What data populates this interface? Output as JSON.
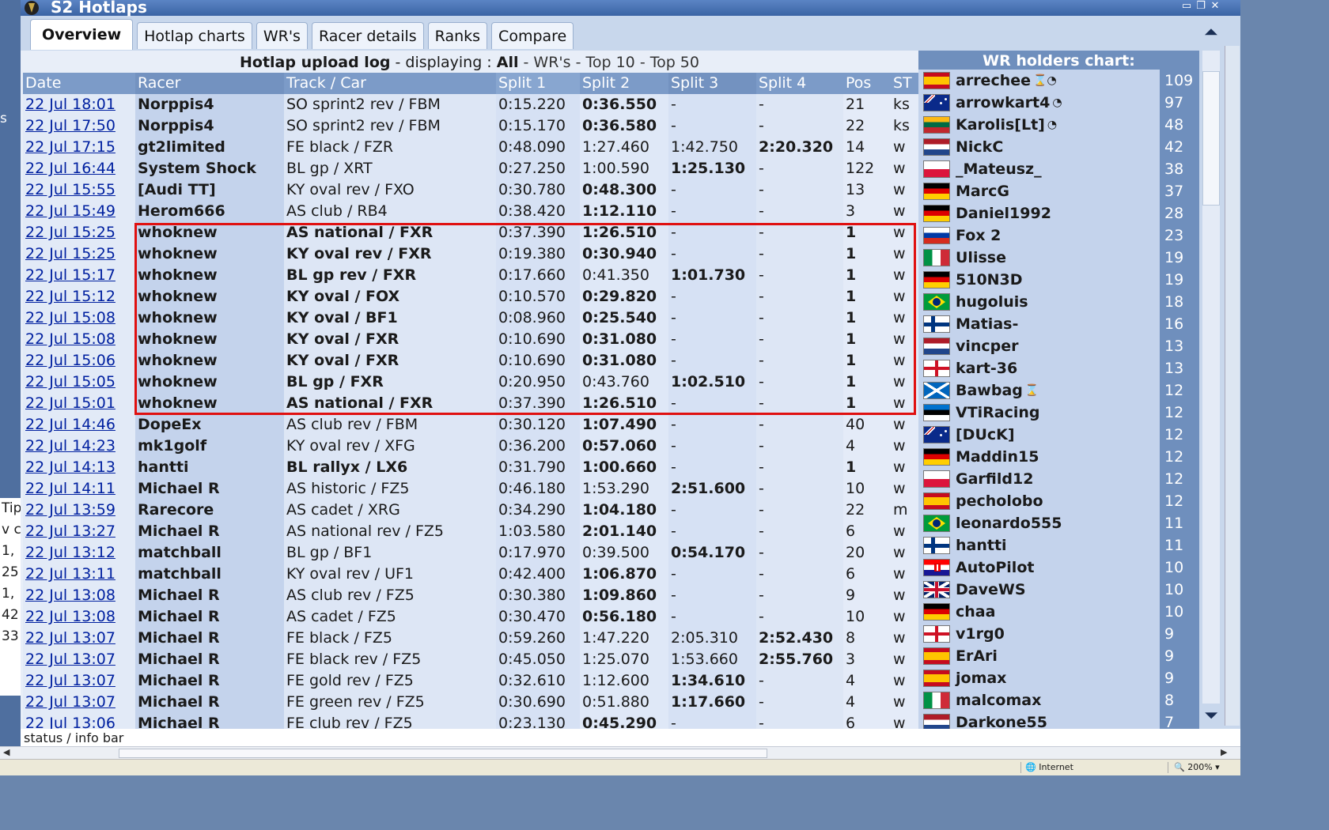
{
  "window": {
    "title": "S2 Hotlaps",
    "buttons": [
      "▭",
      "❐",
      "✕"
    ]
  },
  "background": {
    "left_char": "s",
    "left_lines": [
      "",
      "Tips",
      "v c",
      "1,",
      "25",
      "",
      "1,",
      "42",
      "33"
    ]
  },
  "tabs": [
    "Overview",
    "Hotlap charts",
    "WR's",
    "Racer details",
    "Ranks",
    "Compare"
  ],
  "log": {
    "title": "Hotlap upload log",
    "displaying": "- displaying :",
    "all": "All",
    "links": [
      "- WR's -",
      "Top 10",
      "- Top 50"
    ]
  },
  "table": {
    "headers": [
      "Date",
      "Racer",
      "Track / Car",
      "Split 1",
      "Split 2",
      "Split 3",
      "Split 4",
      "Pos",
      "ST"
    ],
    "rows": [
      {
        "date": "22 Jul 18:01",
        "racer": "Norppis4",
        "track": "SO sprint2 rev / FBM",
        "s1": "0:15.220",
        "s2": "0:36.550",
        "s3": "-",
        "s4": "-",
        "pos": "21",
        "st": "ks",
        "bold": "s2"
      },
      {
        "date": "22 Jul 17:50",
        "racer": "Norppis4",
        "track": "SO sprint2 rev / FBM",
        "s1": "0:15.170",
        "s2": "0:36.580",
        "s3": "-",
        "s4": "-",
        "pos": "22",
        "st": "ks",
        "bold": "s2"
      },
      {
        "date": "22 Jul 17:15",
        "racer": "gt2limited",
        "track": "FE black / FZR",
        "s1": "0:48.090",
        "s2": "1:27.460",
        "s3": "1:42.750",
        "s4": "2:20.320",
        "pos": "14",
        "st": "w",
        "bold": "s4"
      },
      {
        "date": "22 Jul 16:44",
        "racer": "System Shock",
        "track": "BL gp / XRT",
        "s1": "0:27.250",
        "s2": "1:00.590",
        "s3": "1:25.130",
        "s4": "-",
        "pos": "122",
        "st": "w",
        "bold": "s3"
      },
      {
        "date": "22 Jul 15:55",
        "racer": "[Audi TT]",
        "track": "KY oval rev / FXO",
        "s1": "0:30.780",
        "s2": "0:48.300",
        "s3": "-",
        "s4": "-",
        "pos": "13",
        "st": "w",
        "bold": "s2"
      },
      {
        "date": "22 Jul 15:49",
        "racer": "Herom666",
        "track": "AS club / RB4",
        "s1": "0:38.420",
        "s2": "1:12.110",
        "s3": "-",
        "s4": "-",
        "pos": "3",
        "st": "w",
        "bold": "s2"
      },
      {
        "date": "22 Jul 15:25",
        "racer": "whoknew",
        "track": "AS national / FXR",
        "s1": "0:37.390",
        "s2": "1:26.510",
        "s3": "-",
        "s4": "-",
        "pos": "1",
        "st": "w",
        "bold": "s2",
        "wr": true
      },
      {
        "date": "22 Jul 15:25",
        "racer": "whoknew",
        "track": "KY oval rev / FXR",
        "s1": "0:19.380",
        "s2": "0:30.940",
        "s3": "-",
        "s4": "-",
        "pos": "1",
        "st": "w",
        "bold": "s2",
        "wr": true
      },
      {
        "date": "22 Jul 15:17",
        "racer": "whoknew",
        "track": "BL gp rev / FXR",
        "s1": "0:17.660",
        "s2": "0:41.350",
        "s3": "1:01.730",
        "s4": "-",
        "pos": "1",
        "st": "w",
        "bold": "s3",
        "wr": true
      },
      {
        "date": "22 Jul 15:12",
        "racer": "whoknew",
        "track": "KY oval / FOX",
        "s1": "0:10.570",
        "s2": "0:29.820",
        "s3": "-",
        "s4": "-",
        "pos": "1",
        "st": "w",
        "bold": "s2",
        "wr": true
      },
      {
        "date": "22 Jul 15:08",
        "racer": "whoknew",
        "track": "KY oval / BF1",
        "s1": "0:08.960",
        "s2": "0:25.540",
        "s3": "-",
        "s4": "-",
        "pos": "1",
        "st": "w",
        "bold": "s2",
        "wr": true
      },
      {
        "date": "22 Jul 15:08",
        "racer": "whoknew",
        "track": "KY oval / FXR",
        "s1": "0:10.690",
        "s2": "0:31.080",
        "s3": "-",
        "s4": "-",
        "pos": "1",
        "st": "w",
        "bold": "s2",
        "wr": true
      },
      {
        "date": "22 Jul 15:06",
        "racer": "whoknew",
        "track": "KY oval / FXR",
        "s1": "0:10.690",
        "s2": "0:31.080",
        "s3": "-",
        "s4": "-",
        "pos": "1",
        "st": "w",
        "bold": "s2",
        "wr": true
      },
      {
        "date": "22 Jul 15:05",
        "racer": "whoknew",
        "track": "BL gp / FXR",
        "s1": "0:20.950",
        "s2": "0:43.760",
        "s3": "1:02.510",
        "s4": "-",
        "pos": "1",
        "st": "w",
        "bold": "s3",
        "wr": true
      },
      {
        "date": "22 Jul 15:01",
        "racer": "whoknew",
        "track": "AS national / FXR",
        "s1": "0:37.390",
        "s2": "1:26.510",
        "s3": "-",
        "s4": "-",
        "pos": "1",
        "st": "w",
        "bold": "s2",
        "wr": true
      },
      {
        "date": "22 Jul 14:46",
        "racer": "DopeEx",
        "track": "AS club rev / FBM",
        "s1": "0:30.120",
        "s2": "1:07.490",
        "s3": "-",
        "s4": "-",
        "pos": "40",
        "st": "w",
        "bold": "s2"
      },
      {
        "date": "22 Jul 14:23",
        "racer": "mk1golf",
        "track": "KY oval rev / XFG",
        "s1": "0:36.200",
        "s2": "0:57.060",
        "s3": "-",
        "s4": "-",
        "pos": "4",
        "st": "w",
        "bold": "s2"
      },
      {
        "date": "22 Jul 14:13",
        "racer": "hantti",
        "track": "BL rallyx / LX6",
        "s1": "0:31.790",
        "s2": "1:00.660",
        "s3": "-",
        "s4": "-",
        "pos": "1",
        "st": "w",
        "bold": "s2",
        "wr": true
      },
      {
        "date": "22 Jul 14:11",
        "racer": "Michael R",
        "track": "AS historic / FZ5",
        "s1": "0:46.180",
        "s2": "1:53.290",
        "s3": "2:51.600",
        "s4": "-",
        "pos": "10",
        "st": "w",
        "bold": "s3"
      },
      {
        "date": "22 Jul 13:59",
        "racer": "Rarecore",
        "track": "AS cadet / XRG",
        "s1": "0:34.290",
        "s2": "1:04.180",
        "s3": "-",
        "s4": "-",
        "pos": "22",
        "st": "m",
        "bold": "s2"
      },
      {
        "date": "22 Jul 13:27",
        "racer": "Michael R",
        "track": "AS national rev / FZ5",
        "s1": "1:03.580",
        "s2": "2:01.140",
        "s3": "-",
        "s4": "-",
        "pos": "6",
        "st": "w",
        "bold": "s2"
      },
      {
        "date": "22 Jul 13:12",
        "racer": "matchball",
        "track": "BL gp / BF1",
        "s1": "0:17.970",
        "s2": "0:39.500",
        "s3": "0:54.170",
        "s4": "-",
        "pos": "20",
        "st": "w",
        "bold": "s3"
      },
      {
        "date": "22 Jul 13:11",
        "racer": "matchball",
        "track": "KY oval rev / UF1",
        "s1": "0:42.400",
        "s2": "1:06.870",
        "s3": "-",
        "s4": "-",
        "pos": "6",
        "st": "w",
        "bold": "s2"
      },
      {
        "date": "22 Jul 13:08",
        "racer": "Michael R",
        "track": "AS club rev / FZ5",
        "s1": "0:30.380",
        "s2": "1:09.860",
        "s3": "-",
        "s4": "-",
        "pos": "9",
        "st": "w",
        "bold": "s2"
      },
      {
        "date": "22 Jul 13:08",
        "racer": "Michael R",
        "track": "AS cadet / FZ5",
        "s1": "0:30.470",
        "s2": "0:56.180",
        "s3": "-",
        "s4": "-",
        "pos": "10",
        "st": "w",
        "bold": "s2"
      },
      {
        "date": "22 Jul 13:07",
        "racer": "Michael R",
        "track": "FE black / FZ5",
        "s1": "0:59.260",
        "s2": "1:47.220",
        "s3": "2:05.310",
        "s4": "2:52.430",
        "pos": "8",
        "st": "w",
        "bold": "s4"
      },
      {
        "date": "22 Jul 13:07",
        "racer": "Michael R",
        "track": "FE black rev / FZ5",
        "s1": "0:45.050",
        "s2": "1:25.070",
        "s3": "1:53.660",
        "s4": "2:55.760",
        "pos": "3",
        "st": "w",
        "bold": "s4"
      },
      {
        "date": "22 Jul 13:07",
        "racer": "Michael R",
        "track": "FE gold rev / FZ5",
        "s1": "0:32.610",
        "s2": "1:12.600",
        "s3": "1:34.610",
        "s4": "-",
        "pos": "4",
        "st": "w",
        "bold": "s3"
      },
      {
        "date": "22 Jul 13:07",
        "racer": "Michael R",
        "track": "FE green rev / FZ5",
        "s1": "0:30.690",
        "s2": "0:51.880",
        "s3": "1:17.660",
        "s4": "-",
        "pos": "4",
        "st": "w",
        "bold": "s3"
      },
      {
        "date": "22 Jul 13:06",
        "racer": "Michael R",
        "track": "FE club rev / FZ5",
        "s1": "0:23.130",
        "s2": "0:45.290",
        "s3": "-",
        "s4": "-",
        "pos": "6",
        "st": "w",
        "bold": "s2"
      }
    ]
  },
  "wr_chart": {
    "title": "WR holders chart:",
    "holders": [
      {
        "name": "arrechee",
        "count": "109",
        "flag": "es",
        "medals": "⌛◔"
      },
      {
        "name": "arrowkart4",
        "count": "97",
        "flag": "au",
        "medals": "◔"
      },
      {
        "name": "Karolis[Lt]",
        "count": "48",
        "flag": "lt",
        "medals": "◔"
      },
      {
        "name": "NickC",
        "count": "42",
        "flag": "nl",
        "medals": ""
      },
      {
        "name": "_Mateusz_",
        "count": "38",
        "flag": "pl",
        "medals": ""
      },
      {
        "name": "MarcG",
        "count": "37",
        "flag": "de",
        "medals": ""
      },
      {
        "name": "Daniel1992",
        "count": "28",
        "flag": "de",
        "medals": ""
      },
      {
        "name": "Fox 2",
        "count": "23",
        "flag": "ru",
        "medals": ""
      },
      {
        "name": "Ulisse",
        "count": "19",
        "flag": "it",
        "medals": ""
      },
      {
        "name": "510N3D",
        "count": "19",
        "flag": "de",
        "medals": ""
      },
      {
        "name": "hugoluis",
        "count": "18",
        "flag": "br",
        "medals": ""
      },
      {
        "name": "Matias-",
        "count": "16",
        "flag": "fi",
        "medals": ""
      },
      {
        "name": "vincper",
        "count": "13",
        "flag": "nl",
        "medals": ""
      },
      {
        "name": "kart-36",
        "count": "13",
        "flag": "en",
        "medals": ""
      },
      {
        "name": "Bawbag",
        "count": "12",
        "flag": "sc",
        "medals": "⌛"
      },
      {
        "name": "VTiRacing",
        "count": "12",
        "flag": "ee",
        "medals": ""
      },
      {
        "name": "[DUcK]",
        "count": "12",
        "flag": "au",
        "medals": ""
      },
      {
        "name": "Maddin15",
        "count": "12",
        "flag": "de",
        "medals": ""
      },
      {
        "name": "Garfild12",
        "count": "12",
        "flag": "pl",
        "medals": ""
      },
      {
        "name": "pecholobo",
        "count": "12",
        "flag": "es",
        "medals": ""
      },
      {
        "name": "leonardo555",
        "count": "11",
        "flag": "br",
        "medals": ""
      },
      {
        "name": "hantti",
        "count": "11",
        "flag": "fi",
        "medals": ""
      },
      {
        "name": "AutoPilot",
        "count": "10",
        "flag": "hr",
        "medals": ""
      },
      {
        "name": "DaveWS",
        "count": "10",
        "flag": "gb",
        "medals": ""
      },
      {
        "name": "chaa",
        "count": "10",
        "flag": "de",
        "medals": ""
      },
      {
        "name": "v1rg0",
        "count": "9",
        "flag": "en",
        "medals": ""
      },
      {
        "name": "ErAri",
        "count": "9",
        "flag": "es",
        "medals": ""
      },
      {
        "name": "jomax",
        "count": "9",
        "flag": "es",
        "medals": ""
      },
      {
        "name": "malcomax",
        "count": "8",
        "flag": "it",
        "medals": ""
      },
      {
        "name": "Darkone55",
        "count": "7",
        "flag": "nl",
        "medals": ""
      }
    ]
  },
  "scrollbar": {
    "up": "⏶",
    "down": "⏷"
  },
  "status": {
    "text": "status / info bar"
  },
  "ie": {
    "zone": "Internet",
    "zoom": "200%"
  },
  "colors": {
    "highlight": "#e01010",
    "header": "#7c9bc8",
    "wr_panel": "#6f8fbd",
    "title_bar": "#3b64a4"
  }
}
